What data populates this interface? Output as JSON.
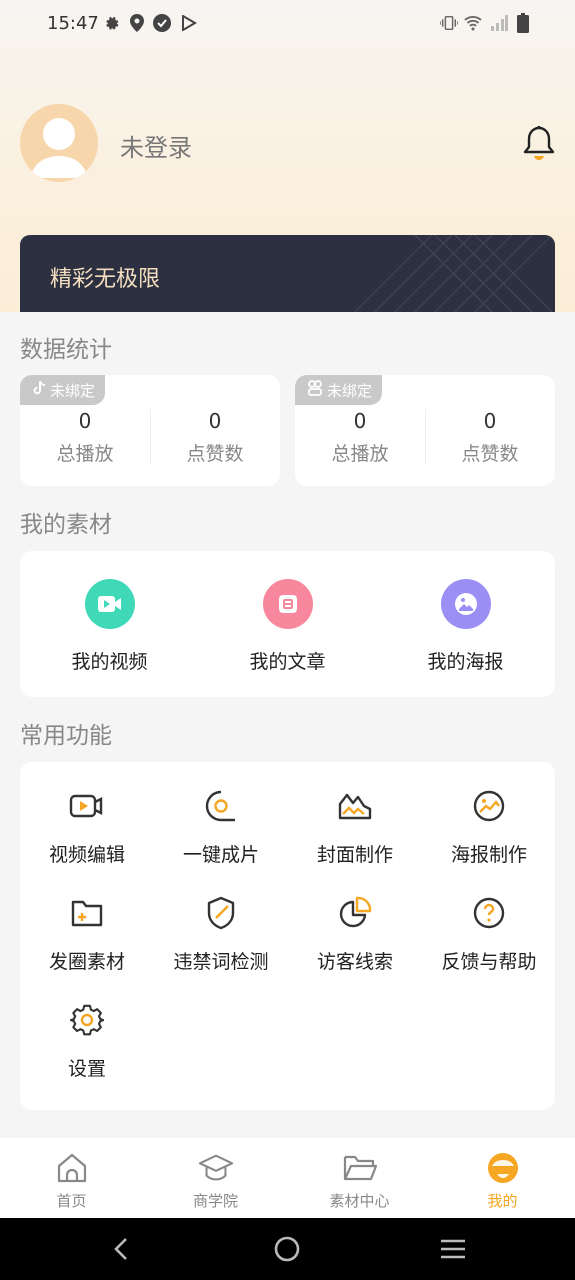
{
  "status_bar": {
    "time": "15:47",
    "left_icons": [
      "gear-icon",
      "location-icon",
      "check-circle-icon",
      "play-store-icon"
    ],
    "right_icons": [
      "vibrate-icon",
      "wifi-icon",
      "signal-icon",
      "battery-icon"
    ]
  },
  "profile": {
    "login_status": "未登录",
    "avatar_icon": "user-avatar-icon",
    "notification_icon": "bell-icon"
  },
  "banner": {
    "text": "精彩无极限"
  },
  "data_stats": {
    "title": "数据统计",
    "cards": [
      {
        "platform_icon": "tiktok-icon",
        "badge": "未绑定",
        "items": [
          {
            "value": "0",
            "label": "总播放"
          },
          {
            "value": "0",
            "label": "点赞数"
          }
        ]
      },
      {
        "platform_icon": "kuaishou-icon",
        "badge": "未绑定",
        "items": [
          {
            "value": "0",
            "label": "总播放"
          },
          {
            "value": "0",
            "label": "点赞数"
          }
        ]
      }
    ]
  },
  "my_materials": {
    "title": "我的素材",
    "items": [
      {
        "label": "我的视频",
        "icon": "video-icon",
        "color": "#3fd9b8"
      },
      {
        "label": "我的文章",
        "icon": "article-icon",
        "color": "#f7879c"
      },
      {
        "label": "我的海报",
        "icon": "poster-icon",
        "color": "#9b8ef5"
      }
    ]
  },
  "common_functions": {
    "title": "常用功能",
    "items": [
      {
        "label": "视频编辑",
        "icon": "video-edit-icon"
      },
      {
        "label": "一键成片",
        "icon": "one-click-film-icon"
      },
      {
        "label": "封面制作",
        "icon": "cover-make-icon"
      },
      {
        "label": "海报制作",
        "icon": "poster-make-icon"
      },
      {
        "label": "发圈素材",
        "icon": "moments-folder-icon"
      },
      {
        "label": "违禁词检测",
        "icon": "shield-check-icon"
      },
      {
        "label": "访客线索",
        "icon": "pie-chart-icon"
      },
      {
        "label": "反馈与帮助",
        "icon": "help-icon"
      },
      {
        "label": "设置",
        "icon": "gear-icon"
      }
    ]
  },
  "tab_bar": {
    "tabs": [
      {
        "label": "首页",
        "icon": "home-icon",
        "active": false
      },
      {
        "label": "商学院",
        "icon": "graduation-cap-icon",
        "active": false
      },
      {
        "label": "素材中心",
        "icon": "folder-icon",
        "active": false
      },
      {
        "label": "我的",
        "icon": "me-face-icon",
        "active": true
      }
    ]
  },
  "colors": {
    "accent": "#f5a623",
    "banner_bg": "#2c3041",
    "banner_text": "#f5dfbf"
  },
  "system_nav": {
    "buttons": [
      "back-icon",
      "home-circle-icon",
      "menu-icon"
    ]
  }
}
